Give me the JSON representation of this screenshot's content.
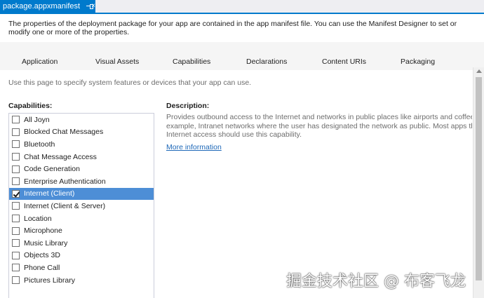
{
  "doc_tab": {
    "title": "package.appxmanifest",
    "close": "×"
  },
  "intro": "The properties of the deployment package for your app are contained in the app manifest file. You can use the Manifest Designer to set or modify one or more of the properties.",
  "tabs": [
    "Application",
    "Visual Assets",
    "Capabilities",
    "Declarations",
    "Content URIs",
    "Packaging"
  ],
  "hint": "Use this page to specify system features or devices that your app can use.",
  "capabilities_label": "Capabilities:",
  "capabilities": [
    {
      "label": "All Joyn",
      "checked": false
    },
    {
      "label": "Blocked Chat Messages",
      "checked": false
    },
    {
      "label": "Bluetooth",
      "checked": false
    },
    {
      "label": "Chat Message Access",
      "checked": false
    },
    {
      "label": "Code Generation",
      "checked": false
    },
    {
      "label": "Enterprise Authentication",
      "checked": false
    },
    {
      "label": "Internet (Client)",
      "checked": true,
      "selected": true
    },
    {
      "label": "Internet (Client & Server)",
      "checked": false
    },
    {
      "label": "Location",
      "checked": false
    },
    {
      "label": "Microphone",
      "checked": false
    },
    {
      "label": "Music Library",
      "checked": false
    },
    {
      "label": "Objects 3D",
      "checked": false
    },
    {
      "label": "Phone Call",
      "checked": false
    },
    {
      "label": "Pictures Library",
      "checked": false
    }
  ],
  "description": {
    "label": "Description:",
    "lines": [
      "Provides outbound access to the Internet and networks in public places like airports and coffee shop",
      "example, Intranet networks where the user has designated the network as public. Most apps that req",
      "Internet access should use this capability."
    ],
    "link": "More information"
  },
  "watermark": "掘金技术社区 @ 布客飞龙",
  "colors": {
    "accent": "#007acc",
    "selection": "#4d8ed6",
    "link": "#1e68b8"
  }
}
